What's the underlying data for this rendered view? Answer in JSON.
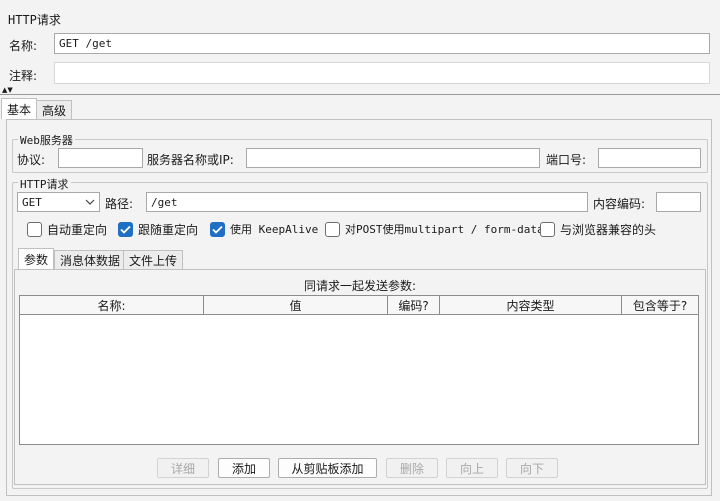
{
  "section_title": "HTTP请求",
  "name_label": "名称:",
  "name_value": "GET /get",
  "comment_label": "注释:",
  "comment_value": "",
  "splitter_arrows": "▲▼",
  "tabs": [
    "基本",
    "高级"
  ],
  "web_server": {
    "title": "Web服务器",
    "protocol_label": "协议:",
    "protocol_value": "",
    "server_label": "服务器名称或IP:",
    "server_value": "",
    "port_label": "端口号:",
    "port_value": ""
  },
  "http_request": {
    "title": "HTTP请求",
    "method": "GET",
    "path_label": "路径:",
    "path_value": "/get",
    "encoding_label": "内容编码:",
    "encoding_value": ""
  },
  "options": [
    {
      "label": "自动重定向",
      "checked": false
    },
    {
      "label": "跟随重定向",
      "checked": true
    },
    {
      "label": "使用 KeepAlive",
      "checked": true
    },
    {
      "label": "对POST使用multipart / form-data",
      "checked": false
    },
    {
      "label": "与浏览器兼容的头",
      "checked": false
    }
  ],
  "sub_tabs": [
    "参数",
    "消息体数据",
    "文件上传"
  ],
  "params_caption": "同请求一起发送参数:",
  "table_headers": [
    "名称:",
    "值",
    "编码?",
    "内容类型",
    "包含等于?"
  ],
  "buttons": [
    {
      "label": "详细",
      "enabled": false
    },
    {
      "label": "添加",
      "enabled": true
    },
    {
      "label": "从剪贴板添加",
      "enabled": true
    },
    {
      "label": "删除",
      "enabled": false
    },
    {
      "label": "向上",
      "enabled": false
    },
    {
      "label": "向下",
      "enabled": false
    }
  ],
  "colors": {
    "check_accent": "#1f6fc4",
    "background": "#f3f3f3"
  }
}
